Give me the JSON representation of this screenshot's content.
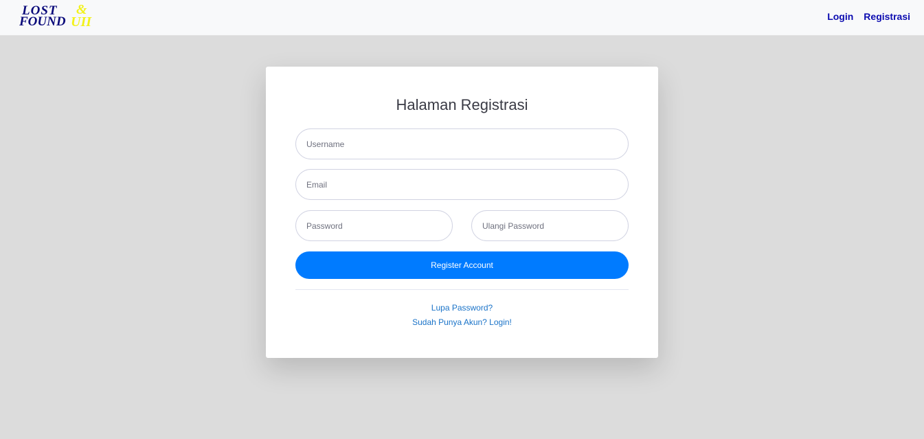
{
  "navbar": {
    "logo": {
      "line1": "LOST",
      "amp": "&",
      "line2": "FOUND",
      "suffix": "UII"
    },
    "links": {
      "login": "Login",
      "register": "Registrasi"
    }
  },
  "form": {
    "title": "Halaman Registrasi",
    "username_placeholder": "Username",
    "email_placeholder": "Email",
    "password_placeholder": "Password",
    "repeat_password_placeholder": "Ulangi Password",
    "submit_label": "Register Account",
    "forgot_link": "Lupa Password?",
    "login_link": "Sudah Punya Akun? Login!"
  },
  "colors": {
    "primary": "#007bff",
    "nav_link": "#0b0bb0",
    "logo_blue": "#0a0a7a",
    "logo_yellow": "#f2f21a",
    "page_bg": "#dcdcdc"
  }
}
